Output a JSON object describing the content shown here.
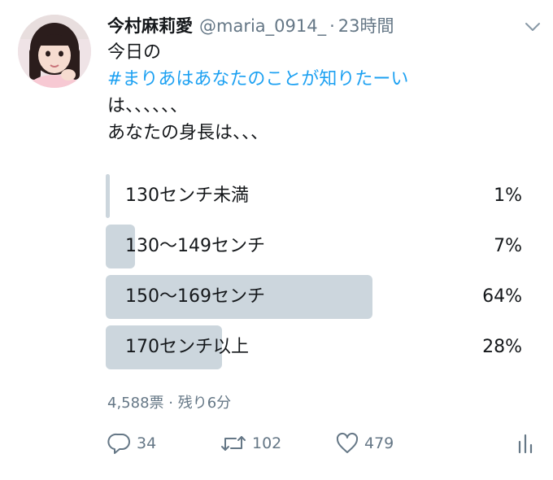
{
  "tweet": {
    "display_name": "今村麻莉愛",
    "handle": "@maria_0914_",
    "separator": "·",
    "time": "23時間",
    "text_lines": {
      "line1": "今日の",
      "hashtag": "#まりあはあなたのことが知りたーい",
      "line3": "は、、、、、、",
      "line4": "あなたの身長は、、、"
    }
  },
  "poll": {
    "choices": [
      {
        "label": "130センチ未満",
        "percent_label": "1%",
        "percent": 1
      },
      {
        "label": "130〜149センチ",
        "percent_label": "7%",
        "percent": 7
      },
      {
        "label": "150〜169センチ",
        "percent_label": "64%",
        "percent": 64
      },
      {
        "label": "170センチ以上",
        "percent_label": "28%",
        "percent": 28
      }
    ],
    "meta": "4,588票 · 残り6分"
  },
  "actions": {
    "reply_count": "34",
    "retweet_count": "102",
    "like_count": "479"
  },
  "colors": {
    "hashtag": "#1da1f2",
    "secondary_text": "#657786",
    "poll_bar": "#ccd6dd"
  },
  "icons": {
    "more": "chevron-down-icon",
    "reply": "reply-icon",
    "retweet": "retweet-icon",
    "like": "heart-icon",
    "analytics": "analytics-icon"
  }
}
